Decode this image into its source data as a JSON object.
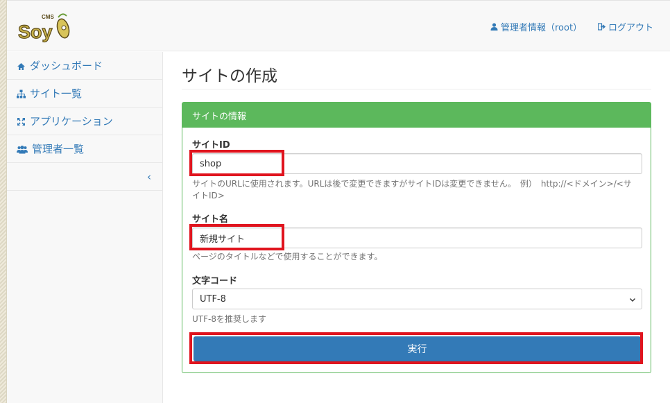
{
  "header": {
    "logo_text": "Soy",
    "logo_sub": "CMS",
    "admin_info_label": "管理者情報（root）",
    "logout_label": "ログアウト",
    "admin_icon": "user-icon",
    "logout_icon": "sign-out-icon"
  },
  "sidebar": {
    "items": [
      {
        "label": "ダッシュボード",
        "icon": "home-icon"
      },
      {
        "label": "サイト一覧",
        "icon": "sitemap-icon"
      },
      {
        "label": "アプリケーション",
        "icon": "expand-icon"
      },
      {
        "label": "管理者一覧",
        "icon": "users-icon"
      }
    ],
    "collapse_label": "‹"
  },
  "main": {
    "title": "サイトの作成",
    "panel_title": "サイトの情報",
    "site_id": {
      "label": "サイトID",
      "value": "shop",
      "help": "サイトのURLに使用されます。URLは後で変更できますがサイトIDは変更できません。　例）　http://<ドメイン>/<サイトID>"
    },
    "site_name": {
      "label": "サイト名",
      "value": "新規サイト",
      "help": "ページのタイトルなどで使用することができます。"
    },
    "charset": {
      "label": "文字コード",
      "value": "UTF-8",
      "help": "UTF-8を推奨します"
    },
    "submit_label": "実行"
  },
  "colors": {
    "accent": "#337ab7",
    "panel_green": "#5cb85c",
    "highlight_red": "#e0141e"
  }
}
